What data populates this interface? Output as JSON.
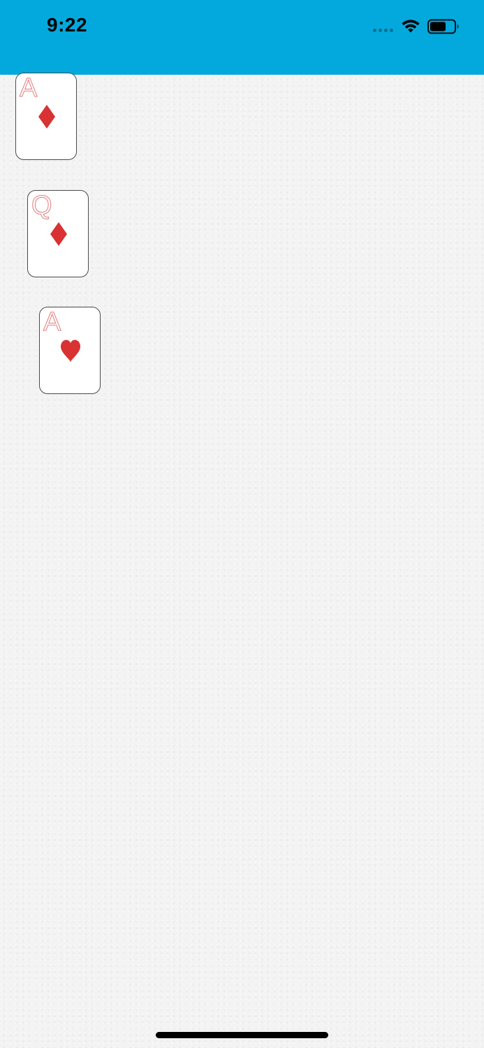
{
  "status_bar": {
    "time": "9:22",
    "background_color": "#03a9dd",
    "icons": [
      "cellular-signal-icon",
      "wifi-icon",
      "battery-icon"
    ]
  },
  "cards": [
    {
      "rank": "A",
      "suit": "diamonds",
      "suit_icon": "diamond-icon",
      "color": "#d83232"
    },
    {
      "rank": "Q",
      "suit": "diamonds",
      "suit_icon": "diamond-icon",
      "color": "#d83232"
    },
    {
      "rank": "A",
      "suit": "hearts",
      "suit_icon": "heart-icon",
      "color": "#d83232"
    }
  ],
  "colors": {
    "accent": "#03a9dd",
    "card_red": "#d83232",
    "rank_pink": "#e37b7b",
    "background": "#f3f3f3"
  }
}
